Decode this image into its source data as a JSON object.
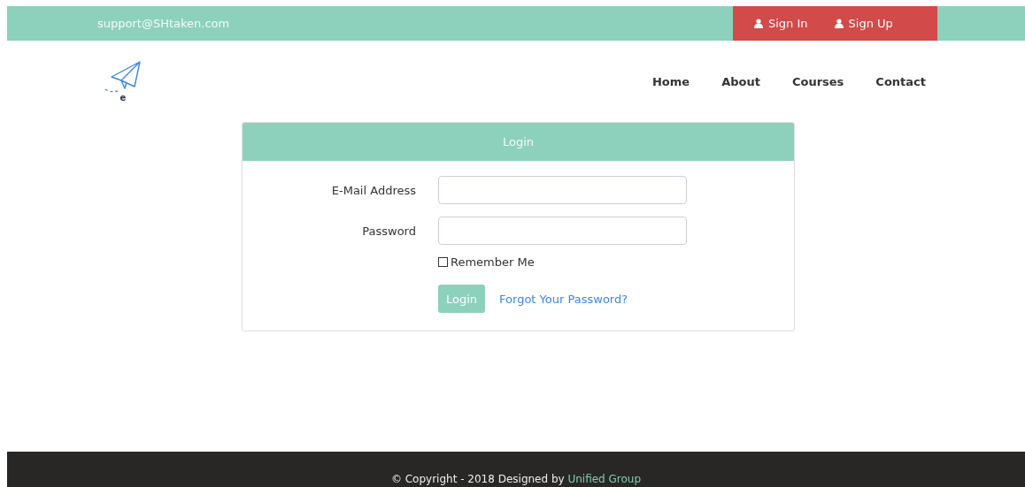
{
  "top_bar": {
    "email": "support@SHtaken.com",
    "buttons": [
      {
        "label": "Sign In"
      },
      {
        "label": "Sign Up"
      }
    ]
  },
  "logo": {
    "letter": "e"
  },
  "nav": {
    "items": [
      {
        "label": "Home"
      },
      {
        "label": "About"
      },
      {
        "label": "Courses"
      },
      {
        "label": "Contact"
      }
    ]
  },
  "login_card": {
    "title": "Login",
    "fields": [
      {
        "label": "E-Mail Address"
      },
      {
        "label": "Password"
      }
    ],
    "remember": {
      "label": "Remember Me",
      "checked": false
    },
    "submit": "Login",
    "forgot_link": "Forgot Your Password?"
  },
  "footer": {
    "text": "© Copyright - 2018 Designed by ",
    "link": "Unified Group"
  }
}
